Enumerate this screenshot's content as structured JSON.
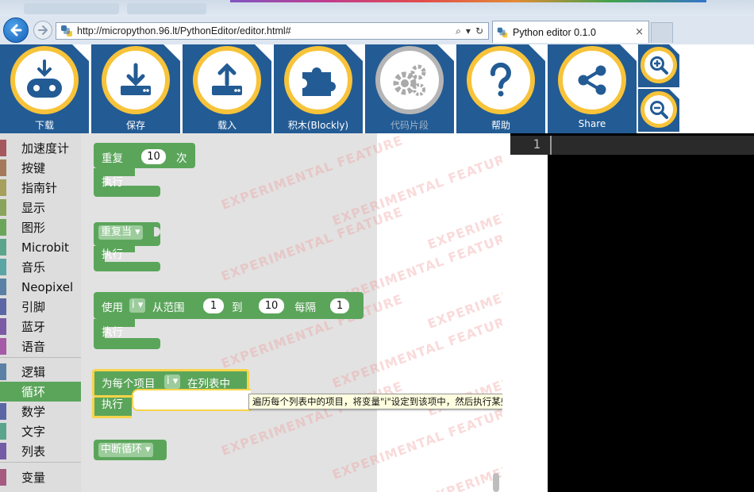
{
  "browser": {
    "url": "http://micropython.96.lt/PythonEditor/editor.html#",
    "tab_title": "Python editor 0.1.0",
    "tab_close": "×",
    "addr_search": "⌕",
    "addr_dropdown": "▾",
    "addr_refresh": "↻"
  },
  "toolbar": {
    "download": "下载",
    "save": "保存",
    "load": "载入",
    "blocks": "积木(Blockly)",
    "snippets": "代码片段",
    "help": "帮助",
    "share": "Share"
  },
  "categories": [
    {
      "label": "加速度计",
      "color": "#a5585d"
    },
    {
      "label": "按键",
      "color": "#a57a5b"
    },
    {
      "label": "指南针",
      "color": "#a5a05b"
    },
    {
      "label": "显示",
      "color": "#8aa55b"
    },
    {
      "label": "图形",
      "color": "#6ba55b"
    },
    {
      "label": "Microbit",
      "color": "#5ba58c"
    },
    {
      "label": "音乐",
      "color": "#5ba5a5"
    },
    {
      "label": "Neopixel",
      "color": "#5b80a5"
    },
    {
      "label": "引脚",
      "color": "#5b67a5"
    },
    {
      "label": "蓝牙",
      "color": "#7b5ba5"
    },
    {
      "label": "语音",
      "color": "#a55ba5"
    },
    {
      "label": "逻辑",
      "color": "#5b80a5"
    },
    {
      "label": "循环",
      "color": "#5ba55b"
    },
    {
      "label": "数学",
      "color": "#5b67a5"
    },
    {
      "label": "文字",
      "color": "#5ba58c"
    },
    {
      "label": "列表",
      "color": "#745ba5"
    },
    {
      "label": "变量",
      "color": "#a55b80"
    }
  ],
  "blocks": {
    "repeat": {
      "label": "重复",
      "count": "10",
      "suffix": "次",
      "do": "执行"
    },
    "while": {
      "label": "重复当",
      "arrow": "▾",
      "do": "执行"
    },
    "for_range": {
      "use": "使用",
      "var": "i",
      "arrow": "▾",
      "from": "从范围",
      "start": "1",
      "to": "到",
      "end": "10",
      "every": "每隔",
      "step": "1",
      "do": "执行"
    },
    "for_each": {
      "label": "为每个项目",
      "var": "i",
      "arrow": "▾",
      "in_list": "在列表中",
      "do": "执行"
    },
    "break": {
      "label": "中断循环",
      "arrow": "▾"
    }
  },
  "tooltip": "遍历每个列表中的项目，将变量\"i\"设定到该项中，然后执行某些语句。",
  "watermark": "EXPERIMENTAL FEATURE",
  "editor": {
    "line_number": "1"
  },
  "colors": {
    "toolbar_bg": "#235b94",
    "tool_ring": "#f7c33a",
    "loop_block": "#5ba55b"
  }
}
